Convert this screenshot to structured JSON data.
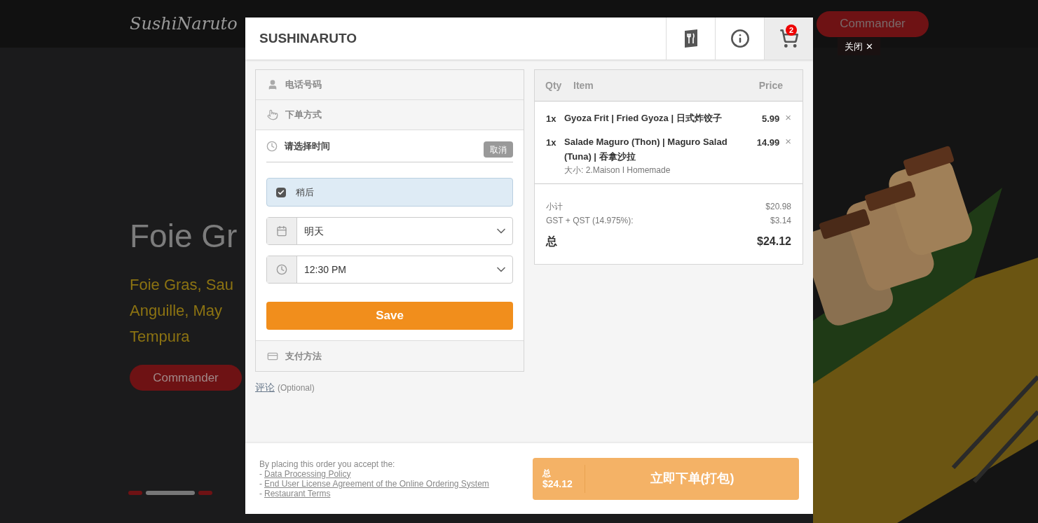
{
  "background": {
    "logo": "SushiNaruto",
    "nav_button": "Commander",
    "hero": {
      "title": "Foie Gr",
      "subtitle_lines": [
        "Foie Gras, Sau",
        "Anguille, May",
        "Tempura"
      ],
      "button": "Commander"
    },
    "slides": [
      {
        "selected": false
      },
      {
        "selected": true
      },
      {
        "selected": false
      }
    ]
  },
  "close_button": "关闭 ✕",
  "modal": {
    "title": "SUSHINARUTO",
    "toolbar": [
      {
        "kind": "menu",
        "selected": false
      },
      {
        "kind": "info",
        "selected": false
      },
      {
        "kind": "cart",
        "selected": true,
        "badge": "2"
      }
    ],
    "checkout": {
      "sections": [
        {
          "kind": "phone",
          "label": "电话号码"
        },
        {
          "kind": "method",
          "label": "下单方式"
        }
      ],
      "time": {
        "title": "请选择时间",
        "cancel": "取消",
        "later": {
          "label": "稍后",
          "checked": true
        },
        "date": "明天",
        "time": "12:30 PM",
        "save": "Save"
      },
      "payment": "支付方法",
      "comment": {
        "link": "评论",
        "hint": "(Optional)"
      }
    },
    "cart": {
      "columns": [
        "Qty",
        "Item",
        "Price"
      ],
      "items": [
        {
          "qty": "1x",
          "name": "Gyoza Frit | Fried Gyoza | 日式炸饺子",
          "price": "5.99",
          "remove": "×"
        },
        {
          "qty": "1x",
          "name": "Salade Maguro (Thon) | Maguro Salad (Tuna) | 吞拿沙拉",
          "option": "大小: 2.Maison I Homemade",
          "price": "14.99",
          "remove": "×"
        }
      ],
      "totals": [
        {
          "kind": "minor",
          "label": "小计",
          "value": "$20.98"
        },
        {
          "kind": "minor",
          "label": "GST + QST (14.975%):",
          "value": "$3.14"
        },
        {
          "kind": "grand",
          "label": "总",
          "value": "$24.12"
        }
      ]
    },
    "footer": {
      "terms_intro": "By placing this order you accept the:",
      "terms": [
        {
          "marker": "-",
          "link": "Data Processing Policy"
        },
        {
          "marker": "-",
          "link": "End User License Agreement of the Online Ordering System"
        },
        {
          "marker": "-",
          "link": "Restaurant Terms"
        }
      ],
      "total_label": "总",
      "total": "$24.12",
      "place_order": "立即下单(打包)"
    }
  }
}
